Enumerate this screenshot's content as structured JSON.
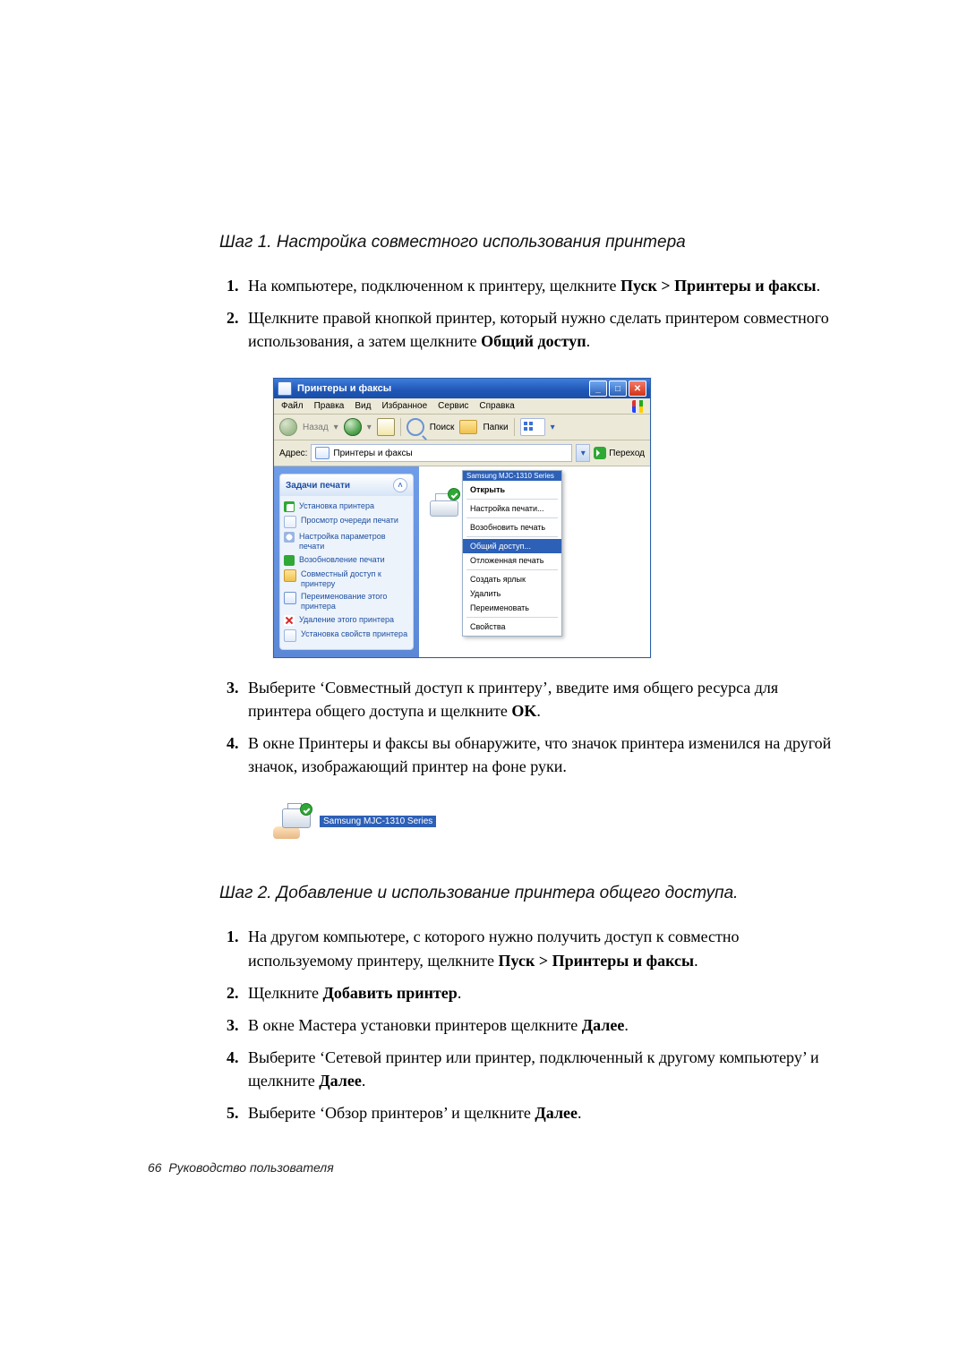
{
  "step1": {
    "heading": "Шаг 1. Настройка совместного использования принтера",
    "items": {
      "0": {
        "a": "На компьютере, подключенном к принтеру, щелкните ",
        "b": "Пуск > Принтеры и факсы",
        "c": "."
      },
      "1": {
        "a": "Щелкните правой кнопкой принтер, который нужно сделать принтером совместного использования, а затем щелкните ",
        "b": "Общий доступ",
        "c": "."
      },
      "2": {
        "a": "Выберите ‘Совместный доступ к принтеру’, введите имя общего ресурса для принтера общего доступа и щелкните ",
        "b": "OK",
        "c": "."
      },
      "3": {
        "a": "В окне Принтеры и факсы вы обнаружите, что значок принтера изменился на другой значок, изображающий принтер на фоне руки."
      }
    }
  },
  "shared_label": "Samsung MJC-1310 Series",
  "window": {
    "title": "Принтеры и факсы",
    "menu": {
      "file": "Файл",
      "edit": "Правка",
      "view": "Вид",
      "fav": "Избранное",
      "tools": "Сервис",
      "help": "Справка"
    },
    "tb": {
      "back": "Назад",
      "search": "Поиск",
      "folders": "Папки"
    },
    "addr": {
      "label": "Адрес:",
      "value": "Принтеры и факсы",
      "go": "Переход"
    },
    "tasks": {
      "head": "Задачи печати",
      "items": {
        "0": "Установка принтера",
        "1": "Просмотр очереди печати",
        "2": "Настройка параметров печати",
        "3": "Возобновление печати",
        "4": "Совместный доступ к принтеру",
        "5": "Переименование этого принтера",
        "6": "Удаление этого принтера",
        "7": "Установка свойств принтера"
      }
    },
    "ctx": {
      "title": "Samsung MJC-1310 Series",
      "open": "Открыть",
      "prefs": "Настройка печати...",
      "resume": "Возобновить печать",
      "share": "Общий доступ...",
      "offline": "Отложенная печать",
      "shortcut": "Создать ярлык",
      "delete": "Удалить",
      "rename": "Переименовать",
      "props": "Свойства"
    }
  },
  "step2": {
    "heading": "Шаг 2. Добавление и использование принтера общего доступа.",
    "items": {
      "0": {
        "a": "На другом компьютере, с которого нужно получить доступ к совместно используемому принтеру, щелкните ",
        "b": "Пуск > Принтеры и факсы",
        "c": "."
      },
      "1": {
        "a": "Щелкните ",
        "b": "Добавить принтер",
        "c": "."
      },
      "2": {
        "a": "В окне Мастера установки принтеров щелкните ",
        "b": "Далее",
        "c": "."
      },
      "3": {
        "a": "Выберите ‘Сетевой принтер или принтер, подключенный к другому компьютеру’ и щелкните ",
        "b": "Далее",
        "c": "."
      },
      "4": {
        "a": "Выберите ‘Обзор принтеров’ и щелкните ",
        "b": "Далее",
        "c": "."
      }
    }
  },
  "footer": {
    "page": "66",
    "label": "Руководство пользователя"
  }
}
